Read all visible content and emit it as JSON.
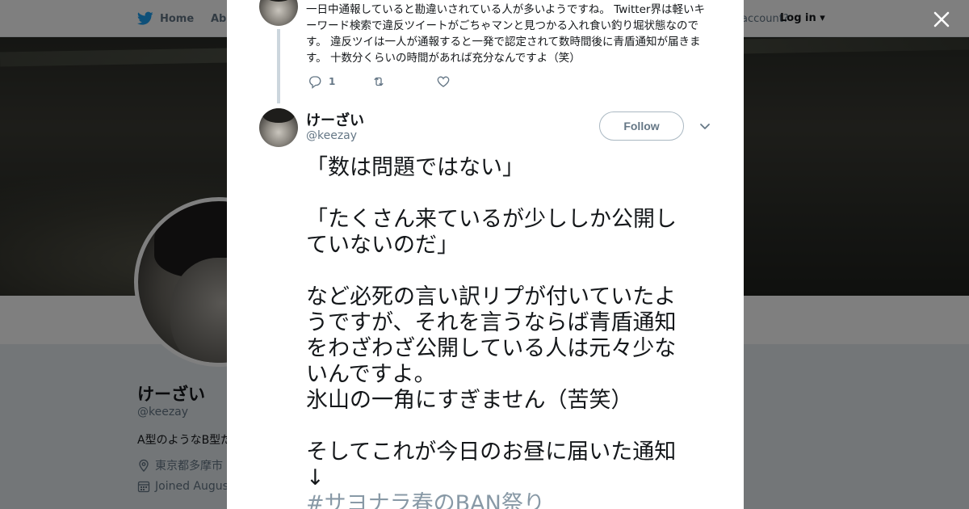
{
  "topnav": {
    "home_label": "Home",
    "about_label": "Abo",
    "account_text": "account?",
    "login_label": "Log in"
  },
  "profile": {
    "name": "けーざい",
    "handle": "@keezay",
    "bio": "A型のようなB型だ",
    "location": "東京都多摩市",
    "joined": "Joined August"
  },
  "previous_tweet": {
    "text": "一日中通報していると勘違いされている人が多いようですね。 Twitter界は軽いキーワード検索で違反ツイートがごちゃマンと見つかる入れ食い釣り堀状態なのです。 違反ツイは一人が通報すると一発で認定されて数時間後に青盾通知が届きます。 十数分くらいの時間があれば充分なんですよ（笑）",
    "reply_count": "1",
    "retweet_count": "",
    "like_count": ""
  },
  "tweet": {
    "author_name": "けーざい",
    "author_handle": "@keezay",
    "follow_label": "Follow",
    "lines": [
      "「数は問題ではない」",
      "",
      "「たくさん来ているが少ししか公開していないのだ」",
      "",
      "など必死の言い訳リプが付いていたようですが、それを言うならば青盾通知をわざわざ公開している人は元々少ないんですよ。",
      "氷山の一角にすぎません（苦笑）",
      "",
      "そしてこれが今日のお昼に届いた通知",
      "↓"
    ],
    "hashtag": "#サヨナラ春のBAN祭り"
  },
  "icons": {
    "bird": "twitter-bird-icon",
    "close": "close-icon",
    "reply": "reply-icon",
    "retweet": "retweet-icon",
    "like": "heart-icon",
    "caret": "chevron-down-icon",
    "location": "location-pin-icon",
    "calendar": "calendar-icon"
  },
  "colors": {
    "brand": "#1da1f2",
    "text": "#14171a",
    "secondary": "#657786",
    "hashtag": "#8899a6"
  }
}
